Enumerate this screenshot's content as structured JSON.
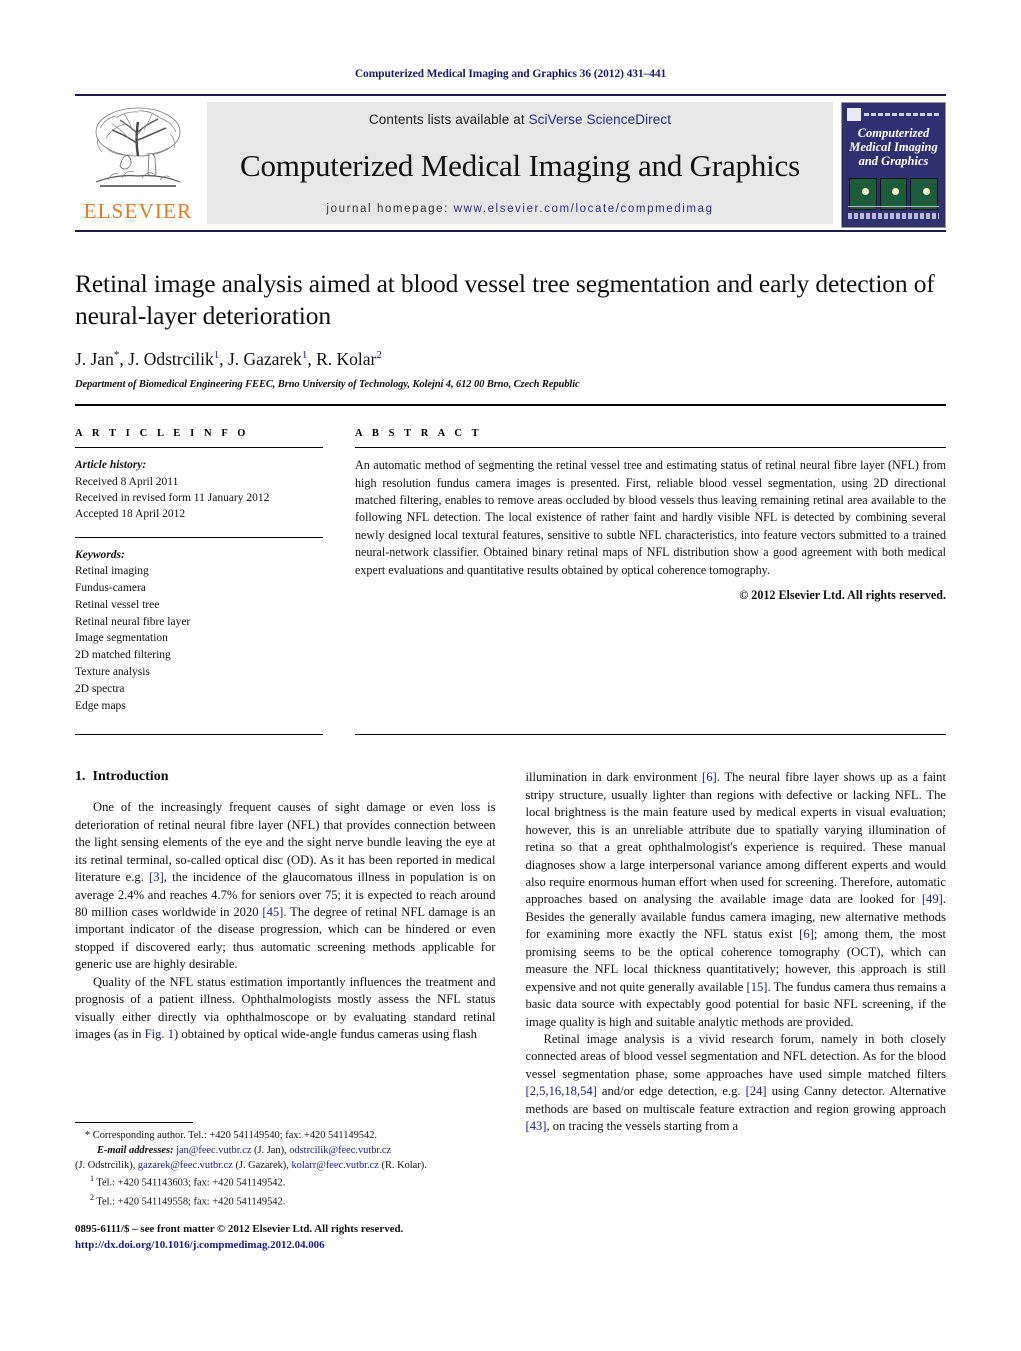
{
  "running_head": "Computerized Medical Imaging and Graphics 36 (2012) 431–441",
  "masthead": {
    "publisher_logo_text": "ELSEVIER",
    "contents_prefix": "Contents lists available at ",
    "contents_link": "SciVerse ScienceDirect",
    "journal_title": "Computerized Medical Imaging and Graphics",
    "homepage_prefix": "journal homepage: ",
    "homepage_link": "www.elsevier.com/locate/compmedimag",
    "cover_title": "Computerized Medical Imaging and Graphics"
  },
  "article": {
    "title": "Retinal image analysis aimed at blood vessel tree segmentation and early detection of neural-layer deterioration",
    "authors_plain": "J. Jan*, J. Odstrcilik 1, J. Gazarek 1, R. Kolar 2",
    "authors": [
      {
        "name": "J. Jan",
        "sup": "*"
      },
      {
        "name": "J. Odstrcilik",
        "sup": "1"
      },
      {
        "name": "J. Gazarek",
        "sup": "1"
      },
      {
        "name": "R. Kolar",
        "sup": "2"
      }
    ],
    "affiliation": "Department of Biomedical Engineering FEEC, Brno University of Technology, Kolejní 4, 612 00 Brno, Czech Republic"
  },
  "article_info": {
    "heading": "A R T I C L E   I N F O",
    "history_label": "Article history:",
    "history": [
      "Received 8 April 2011",
      "Received in revised form 11 January 2012",
      "Accepted 18 April 2012"
    ],
    "keywords_label": "Keywords:",
    "keywords": [
      "Retinal imaging",
      "Fundus-camera",
      "Retinal vessel tree",
      "Retinal neural fibre layer",
      "Image segmentation",
      "2D matched filtering",
      "Texture analysis",
      "2D spectra",
      "Edge maps"
    ]
  },
  "abstract": {
    "heading": "A B S T R A C T",
    "text": "An automatic method of segmenting the retinal vessel tree and estimating status of retinal neural fibre layer (NFL) from high resolution fundus camera images is presented. First, reliable blood vessel segmentation, using 2D directional matched filtering, enables to remove areas occluded by blood vessels thus leaving remaining retinal area available to the following NFL detection. The local existence of rather faint and hardly visible NFL is detected by combining several newly designed local textural features, sensitive to subtle NFL characteristics, into feature vectors submitted to a trained neural-network classifier. Obtained binary retinal maps of NFL distribution show a good agreement with both medical expert evaluations and quantitative results obtained by optical coherence tomography.",
    "copyright": "© 2012 Elsevier Ltd. All rights reserved."
  },
  "introduction": {
    "number": "1.",
    "title": "Introduction",
    "left_paragraphs": [
      "One of the increasingly frequent causes of sight damage or even loss is deterioration of retinal neural fibre layer (NFL) that provides connection between the light sensing elements of the eye and the sight nerve bundle leaving the eye at its retinal terminal, so-called optical disc (OD). As it has been reported in medical literature e.g. [3], the incidence of the glaucomatous illness in population is on average 2.4% and reaches 4.7% for seniors over 75; it is expected to reach around 80 million cases worldwide in 2020 [45]. The degree of retinal NFL damage is an important indicator of the disease progression, which can be hindered or even stopped if discovered early; thus automatic screening methods applicable for generic use are highly desirable.",
      "Quality of the NFL status estimation importantly influences the treatment and prognosis of a patient illness. Ophthalmologists mostly assess the NFL status visually either directly via ophthalmoscope or by evaluating standard retinal images (as in Fig. 1) obtained by optical wide-angle fundus cameras using flash"
    ],
    "right_paragraphs": [
      "illumination in dark environment [6]. The neural fibre layer shows up as a faint stripy structure, usually lighter than regions with defective or lacking NFL. The local brightness is the main feature used by medical experts in visual evaluation; however, this is an unreliable attribute due to spatially varying illumination of retina so that a great ophthalmologist's experience is required. These manual diagnoses show a large interpersonal variance among different experts and would also require enormous human effort when used for screening. Therefore, automatic approaches based on analysing the available image data are looked for [49]. Besides the generally available fundus camera imaging, new alternative methods for examining more exactly the NFL status exist [6]; among them, the most promising seems to be the optical coherence tomography (OCT), which can measure the NFL local thickness quantitatively; however, this approach is still expensive and not quite generally available [15]. The fundus camera thus remains a basic data source with expectably good potential for basic NFL screening, if the image quality is high and suitable analytic methods are provided.",
      "Retinal image analysis is a vivid research forum, namely in both closely connected areas of blood vessel segmentation and NFL detection. As for the blood vessel segmentation phase, some approaches have used simple matched filters [2,5,16,18,54] and/or edge detection, e.g. [24] using Canny detector. Alternative methods are based on multiscale feature extraction and region growing approach [43], on tracing the vessels starting from a"
    ]
  },
  "footnotes": {
    "corresponding": "* Corresponding author. Tel.: +420 541149540; fax: +420 541149542.",
    "email_label": "E-mail addresses:",
    "emails_line1_link": "jan@feec.vutbr.cz",
    "emails_line1_name": " (J. Jan), ",
    "emails_line1_link2": "odstrcilik@feec.vutbr.cz",
    "emails_line2_name": "(J. Odstrcilik), ",
    "emails_line2_link": "gazarek@feec.vutbr.cz",
    "emails_line2_name2": " (J. Gazarek), ",
    "emails_line2_link2": "kolarr@feec.vutbr.cz",
    "emails_line2_name3": " (R. Kolar).",
    "note1": "Tel.: +420 541143603; fax: +420 541149542.",
    "note2": "Tel.: +420 541149558; fax: +420 541149542.",
    "note1_sup": "1",
    "note2_sup": "2"
  },
  "issn": {
    "line1": "0895-6111/$ – see front matter © 2012 Elsevier Ltd. All rights reserved.",
    "doi": "http://dx.doi.org/10.1016/j.compmedimag.2012.04.006"
  },
  "colors": {
    "link": "#2b2b8f",
    "reference": "#1a1a8c",
    "running_head": "#1a1a66",
    "elsevier_orange": "#E87722",
    "band_grey": "#e7e7e7",
    "cover_navy": "#2f3070"
  }
}
